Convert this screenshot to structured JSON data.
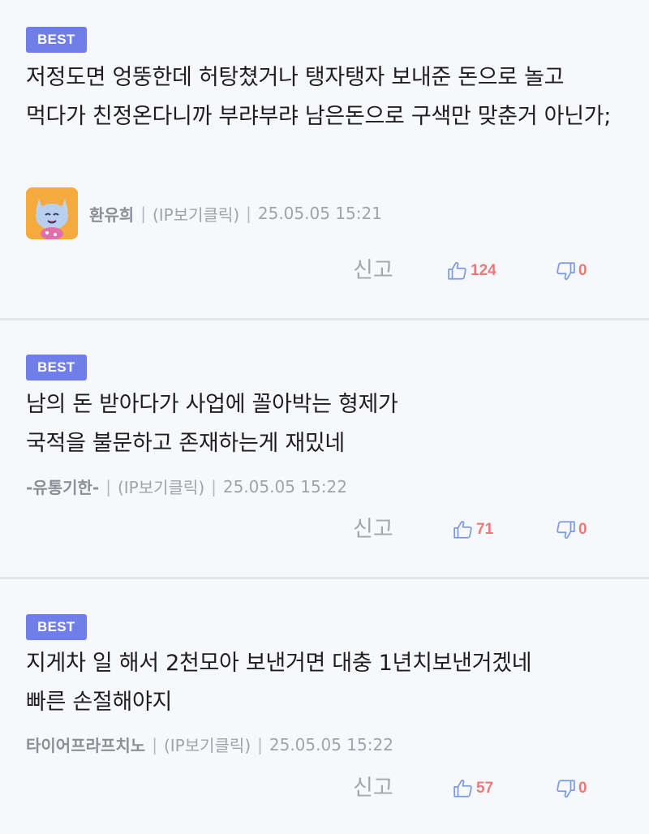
{
  "comments": [
    {
      "badge": "BEST",
      "text": "저정도면 엉뚱한데 허탕쳤거나 탱자탱자 보내준 돈으로 놀고 먹다가 친정온다니까 부랴부랴 남은돈으로 구색만 맞춘거 아닌가;",
      "author": "환유희",
      "ip_label": "(IP보기클릭)",
      "timestamp": "25.05.05 15:21",
      "report_label": "신고",
      "likes": "124",
      "dislikes": "0",
      "has_avatar": true
    },
    {
      "badge": "BEST",
      "text": "남의 돈 받아다가 사업에 꼴아박는 형제가\n국적을 불문하고 존재하는게 재밌네",
      "author": "-유통기한-",
      "ip_label": "(IP보기클릭)",
      "timestamp": "25.05.05 15:22",
      "report_label": "신고",
      "likes": "71",
      "dislikes": "0",
      "has_avatar": false
    },
    {
      "badge": "BEST",
      "text": "지게차 일 해서 2천모아 보낸거면 대충 1년치보낸거겠네\n빠른 손절해야지",
      "author": "타이어프라프치노",
      "ip_label": "(IP보기클릭)",
      "timestamp": "25.05.05 15:22",
      "report_label": "신고",
      "likes": "57",
      "dislikes": "0",
      "has_avatar": false
    }
  ],
  "separator": "|",
  "icons": {
    "like": "thumbs-up-icon",
    "dislike": "thumbs-down-icon",
    "avatar": "cat-avatar-icon"
  },
  "colors": {
    "badge": "#6f7ee9",
    "vote_count": "#e97a7a",
    "icon": "#7a9be0",
    "background": "#f7f8fc",
    "divider": "#e3e4ea"
  }
}
